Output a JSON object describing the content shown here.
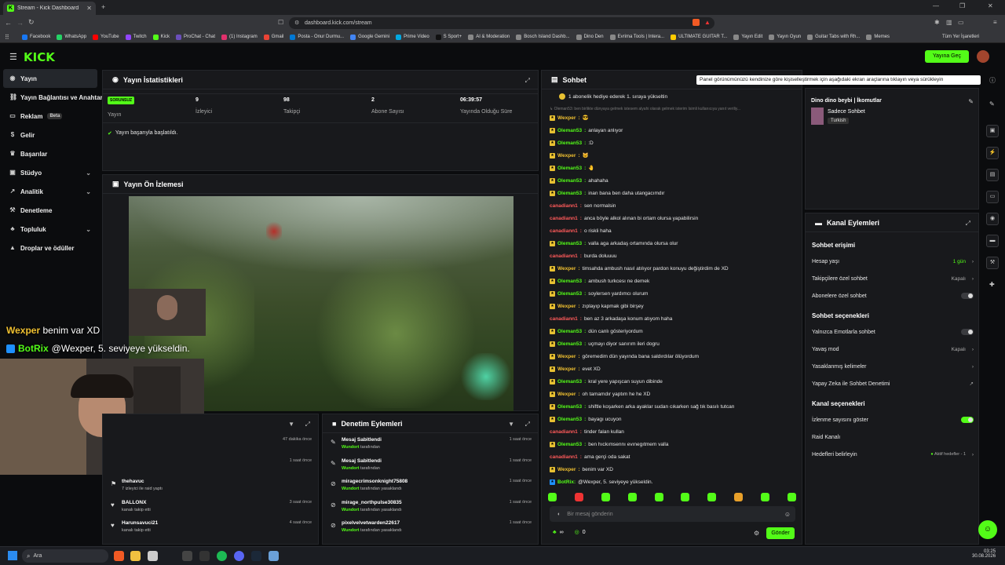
{
  "browser": {
    "tab_title": "Stream - Kick Dashboard",
    "url": "dashboard.kick.com/stream",
    "bookmarks": [
      "Facebook",
      "WhatsApp",
      "YouTube",
      "Twitch",
      "Kick",
      "ProChat - Chat",
      "(1) Instagram",
      "Gmail",
      "Posta - Onur Durmu...",
      "Google Gemini",
      "Prime Video",
      "S Sport+",
      "AI & Moderation",
      "Bosch Island Dashb...",
      "Dino Den",
      "Evrima Tools | Intera...",
      "ULTIMATE GUITAR T...",
      "Yayın Edit",
      "Yayın Oyun",
      "Guitar Tabs with Rh...",
      "Memes"
    ],
    "bookmarks_all": "Tüm Yer İşaretleri"
  },
  "header": {
    "logo": "KICK",
    "go_live": "Yayına Geç"
  },
  "sidebar": {
    "items": [
      {
        "label": "Yayın",
        "icon": "eye-icon"
      },
      {
        "label": "Yayın Bağlantısı ve Anahtarı",
        "icon": "link-icon"
      },
      {
        "label": "Reklam",
        "icon": "ad-icon",
        "badge": "Beta"
      },
      {
        "label": "Gelir",
        "icon": "dollar-icon"
      },
      {
        "label": "Başarılar",
        "icon": "trophy-icon"
      },
      {
        "label": "Stüdyo",
        "icon": "studio-icon"
      },
      {
        "label": "Analitik",
        "icon": "chart-icon"
      },
      {
        "label": "Denetleme",
        "icon": "hammer-icon"
      },
      {
        "label": "Topluluk",
        "icon": "community-icon"
      },
      {
        "label": "Droplar ve ödüller",
        "icon": "gift-icon"
      }
    ]
  },
  "stats": {
    "title": "Yayın İstatistikleri",
    "status_badge": "SORUNSUZ",
    "cards": [
      {
        "value": "",
        "label": "Yayın"
      },
      {
        "value": "9",
        "label": "İzleyici"
      },
      {
        "value": "98",
        "label": "Takipçi"
      },
      {
        "value": "2",
        "label": "Abone Sayısı"
      },
      {
        "value": "06:39:57",
        "label": "Yayında Olduğu Süre"
      }
    ],
    "started_msg": "Yayın başarıyla başlatıldı."
  },
  "preview": {
    "title": "Yayın Ön İzlemesi"
  },
  "overlay": {
    "line1_user": "Wexper",
    "line1_text": "benim var XD",
    "line2_user": "BotRix",
    "line2_text": "@Wexper, 5. seviyeye yükseldin."
  },
  "activity": {
    "rows": [
      {
        "name": "",
        "sub": "",
        "time": "47 dakika önce"
      },
      {
        "name": "",
        "sub": "",
        "time": "1 saat önce"
      },
      {
        "name": "thehavuc",
        "sub": "7 izleyici ile raid yaptı",
        "time": ""
      },
      {
        "name": "BALLONX",
        "sub": "kanalı takip etti",
        "time": "3 saat önce"
      },
      {
        "name": "Harunsavuci21",
        "sub": "kanalı takip etti",
        "time": "4 saat önce"
      }
    ]
  },
  "moderation": {
    "title": "Denetim Eylemleri",
    "rows": [
      {
        "name": "Mesaj Sabitlendi",
        "by": "Wundort",
        "sub": "tarafından",
        "time": "1 saat önce"
      },
      {
        "name": "Mesaj Sabitlendi",
        "by": "Wundort",
        "sub": "tarafından",
        "time": "1 saat önce"
      },
      {
        "name": "miragecrimsonknight75808",
        "by": "Wundort",
        "sub": "tarafından yasaklandı",
        "time": "1 saat önce"
      },
      {
        "name": "mirage_northpulse30835",
        "by": "Wundort",
        "sub": "tarafından yasaklandı",
        "time": "1 saat önce"
      },
      {
        "name": "pixelvelvetwarden22617",
        "by": "Wundort",
        "sub": "tarafından yasaklandı",
        "time": "1 saat önce"
      }
    ]
  },
  "chat": {
    "title": "Sohbet",
    "pinned": "1 abonelik hediye ederek 1. sıraya yükseltin",
    "pinned2": "↳ Oleman53: ben birlikte dünyaya gelmek istesem alyahi olarak gelmek isterim İsimli kullanıcıya yanıt veriliy...",
    "messages": [
      {
        "u": "Wexper",
        "c": "u2",
        "t": "😎"
      },
      {
        "u": "Oleman53",
        "c": "u1",
        "t": "anlayan anlıyor"
      },
      {
        "u": "Oleman53",
        "c": "u1",
        "t": ":D"
      },
      {
        "u": "Wexper",
        "c": "u2",
        "t": "🐱"
      },
      {
        "u": "Oleman53",
        "c": "u1",
        "t": "🤚"
      },
      {
        "u": "Oleman53",
        "c": "u1",
        "t": "ahahaha"
      },
      {
        "u": "Oleman53",
        "c": "u1",
        "t": "inan bana ben daha utangacımdır"
      },
      {
        "u": "canadiann1",
        "c": "u3",
        "t": "sen normalsin"
      },
      {
        "u": "canadiann1",
        "c": "u3",
        "t": "anca böyle alkol alınan bi ortam olursa yapabilirsin"
      },
      {
        "u": "canadiann1",
        "c": "u3",
        "t": "o riskli haha"
      },
      {
        "u": "Oleman53",
        "c": "u1",
        "t": "valla aga arkadaş ortamında olursa olur"
      },
      {
        "u": "canadiann1",
        "c": "u3",
        "t": "burda doluuuu"
      },
      {
        "u": "Wexper",
        "c": "u2",
        "t": "timsahda ambush nasıl atılıyor pardon konuyu değiştirdim de XD"
      },
      {
        "u": "Oleman53",
        "c": "u1",
        "t": "ambush turkcesı ne demek"
      },
      {
        "u": "Oleman53",
        "c": "u1",
        "t": "soylersen yardımcı olurum"
      },
      {
        "u": "Wexper",
        "c": "u2",
        "t": "zıplayıp kapmak gibi birşey"
      },
      {
        "u": "canadiann1",
        "c": "u3",
        "t": "ben az 3 arkadaşa konum atıyom haha"
      },
      {
        "u": "Oleman53",
        "c": "u1",
        "t": "dün canlı gösteriyordum"
      },
      {
        "u": "Oleman53",
        "c": "u1",
        "t": "uçmayı diyor sanırım ileri dogru"
      },
      {
        "u": "Wexper",
        "c": "u2",
        "t": "göremedim dün yayında bana saldırdılar ölüyordum"
      },
      {
        "u": "Wexper",
        "c": "u2",
        "t": "evet XD"
      },
      {
        "u": "Oleman53",
        "c": "u1",
        "t": "kral yere yapışcan suyun dibinde"
      },
      {
        "u": "Wexper",
        "c": "u2",
        "t": "oh tamamdır yaptım he he XD"
      },
      {
        "u": "Oleman53",
        "c": "u1",
        "t": "shiftle koşarken arka ayaklar sudan cıkarken sağ tık basılı tutcan"
      },
      {
        "u": "Oleman53",
        "c": "u1",
        "t": "bayagı ucuyon"
      },
      {
        "u": "canadiann1",
        "c": "u3",
        "t": "tinder falan kullan"
      },
      {
        "u": "Oleman53",
        "c": "u1",
        "t": "ben hıckımsennı evınegıtmem valla"
      },
      {
        "u": "canadiann1",
        "c": "u3",
        "t": "ama gerçi oda sakat"
      },
      {
        "u": "Wexper",
        "c": "u2",
        "t": "benim var XD"
      },
      {
        "u": "BotRix:",
        "c": "u1",
        "t": "@Wexper, 5. seviyeye yükseldin."
      }
    ],
    "input_placeholder": "Bir mesaj gönderin",
    "send": "Gönder",
    "count_a": "∞",
    "count_b": "0"
  },
  "tooltip": "Panel görünümünüzü kendinize göre kişiselleştirmek için aşağıdaki ekran araçlarına tıklayın veya sürükleyin",
  "channel_info": {
    "title": "Dino dino beybi | İkomutlar",
    "mode": "Sadece Sohbet",
    "lang": "Turkish"
  },
  "channel_actions": {
    "title": "Kanal Eylemleri",
    "sec1": "Sohbet erişimi",
    "rows1": [
      {
        "label": "Hesap yaşı",
        "value": "1 gün"
      },
      {
        "label": "Takipçilere özel sohbet",
        "value": "Kapalı"
      },
      {
        "label": "Abonelere özel sohbet",
        "value": ""
      }
    ],
    "sec2": "Sohbet seçenekleri",
    "rows2": [
      {
        "label": "Yalnızca Emotlarla sohbet",
        "value": ""
      },
      {
        "label": "Yavaş mod",
        "value": "Kapalı"
      },
      {
        "label": "Yasaklanmış kelimeler",
        "value": ""
      },
      {
        "label": "Yapay Zeka ile Sohbet Denetimi",
        "value": ""
      }
    ],
    "sec3": "Kanal seçenekleri",
    "rows3": [
      {
        "label": "İzlenme sayısını göster",
        "value": ""
      },
      {
        "label": "Raid Kanalı",
        "value": ""
      },
      {
        "label": "Hedefleri belirleyin",
        "value": "Aktif hedefler - 1"
      }
    ]
  },
  "taskbar": {
    "search": "Ara",
    "time": "03:25",
    "date": "30.08.2026"
  }
}
